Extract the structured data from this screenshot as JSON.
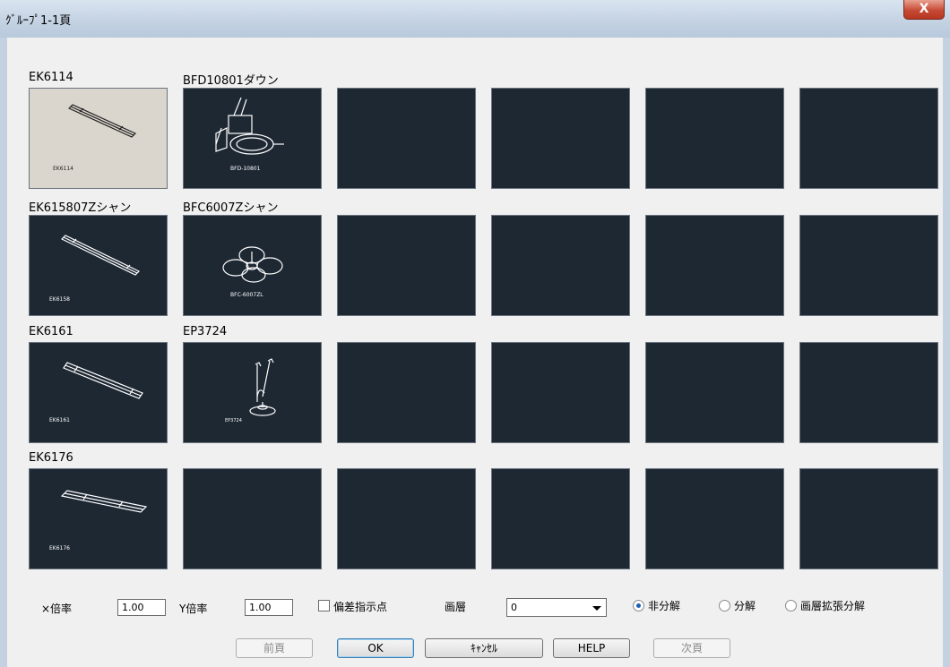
{
  "window": {
    "title": "ｸﾞﾙｰﾌﾟ1-1頁",
    "close_label": "X"
  },
  "grid": {
    "labels": [
      "EK6114",
      "BFD10801ダウン",
      "EK615807Zシャン",
      "BFC6007Zシャン",
      "EK6161",
      "EP3724",
      "EK6176"
    ],
    "captions": [
      "EK6114",
      "BFD-10801",
      "EK6158",
      "BFC-6007ZL",
      "EK6161",
      "EP3724",
      "EK6176"
    ]
  },
  "options": {
    "x_scale_label": "×倍率",
    "x_scale_value": "1.00",
    "y_scale_label": "Y倍率",
    "y_scale_value": "1.00",
    "offset_point_label": "偏差指示点",
    "offset_point_checked": false,
    "layer_label": "画層",
    "layer_value": "0",
    "radio_options": [
      "非分解",
      "分解",
      "画層拡張分解"
    ],
    "radio_selected": 0
  },
  "buttons": {
    "prev": "前頁",
    "ok": "OK",
    "cancel": "ｷｬﾝｾﾙ",
    "help": "HELP",
    "next": "次頁"
  }
}
